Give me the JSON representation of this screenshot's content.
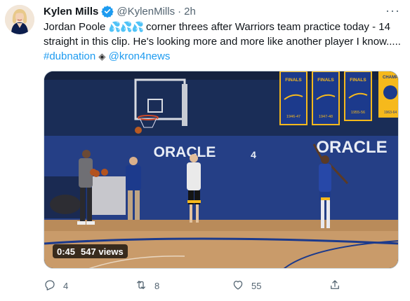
{
  "tweet": {
    "author_name": "Kylen Mills",
    "author_handle": "@KylenMills",
    "separator": "·",
    "time_ago": "2h",
    "more_label": "···",
    "text_before_emoji": "Jordan Poole",
    "emoji_drops": "💦💦💦",
    "text_after_emoji": " corner threes after Warriors team practice today - 14 straight in this clip. He's looking more and more like another player I know..... ",
    "hashtag": "#dubnation",
    "team_emoji": "◈",
    "mention": "@kron4news",
    "icons": {
      "verified": "verified-badge-icon",
      "reply": "reply-icon",
      "retweet": "retweet-icon",
      "like": "heart-icon",
      "share": "share-icon"
    }
  },
  "media": {
    "type": "video",
    "duration": "0:45",
    "views": "547 views",
    "court_sign_left": "ORACLE",
    "court_sign_right": "ORACLE",
    "wall_number": "4",
    "banner_label": "FINALS",
    "banner_years": [
      "1946-47",
      "1947-48",
      "1955-56"
    ],
    "end_banner_label": "CHAMP",
    "end_banner_year": "1963-64",
    "colors": {
      "wall": "#1f3566",
      "padding": "#253f86",
      "banner": "#1c3a8c",
      "gold": "#f6b91c",
      "floor": "#c99b6a"
    }
  },
  "actions": {
    "reply_count": "4",
    "retweet_count": "8",
    "like_count": "55"
  },
  "accent_color": "#1d9bf0"
}
